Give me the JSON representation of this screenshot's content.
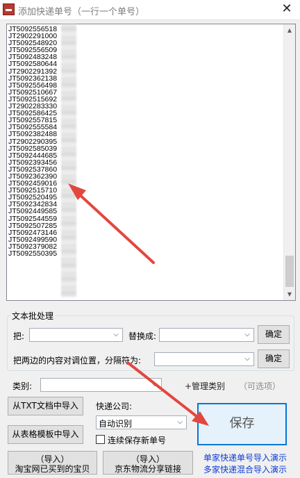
{
  "window": {
    "title": "添加快递单号（一行一个单号）",
    "close_glyph": "✕"
  },
  "tracking_list": {
    "lines": [
      "JT5092556518",
      "JT2902291000",
      "JT5092548920",
      "JT5092556509",
      "JT5092483248",
      "JT5092580644",
      "JT2902291392",
      "JT5092362138",
      "JT5092556498",
      "JT5092510667",
      "JT5092515692",
      "JT2902283330",
      "JT5092586425",
      "JT5092557815",
      "JT5092555584",
      "JT5092382488",
      "JT2902290395",
      "JT5092585039",
      "JT5092444685",
      "JT5092393456",
      "JT5092537860",
      "JT5092362390",
      "JT5092459016",
      "JT5092515710",
      "JT5092520495",
      "JT5092342834",
      "JT5092449585",
      "JT5092544559",
      "JT5092507285",
      "JT5092473146",
      "JT5092499590",
      "JT5092379082",
      "JT5092550395"
    ],
    "scroll_up": "▲",
    "scroll_down": "▼"
  },
  "batch": {
    "group_title": "文本批处理",
    "replace_from_label": "把:",
    "replace_from_value": "",
    "replace_to_label": "替换成:",
    "replace_to_value": "",
    "confirm_label": "确定",
    "swap_label": "把两边的内容对调位置，分隔符为:",
    "swap_value": "",
    "confirm2_label": "确定"
  },
  "category": {
    "label": "类别:",
    "value": "",
    "manage_link": "+管理类别",
    "optional": "（可选项）"
  },
  "courier": {
    "label": "快递公司:",
    "value": "自动识别"
  },
  "buttons": {
    "import_txt": "从TXT文档中导入",
    "import_template": "从表格模板中导入",
    "save": "保存",
    "continuous_label": "连续保存新单号",
    "import_taobao_line1": "（导入）",
    "import_taobao_line2": "淘宝网已买到的宝贝",
    "import_jd_line1": "（导入）",
    "import_jd_line2": "京东物流分享链接"
  },
  "links": {
    "single_demo": "单家快递单号导入演示",
    "multi_demo": "多家快递混合导入演示"
  },
  "colors": {
    "accent": "#0078d7",
    "link": "#0b3bd6",
    "annotation_arrow": "#e2473f"
  }
}
